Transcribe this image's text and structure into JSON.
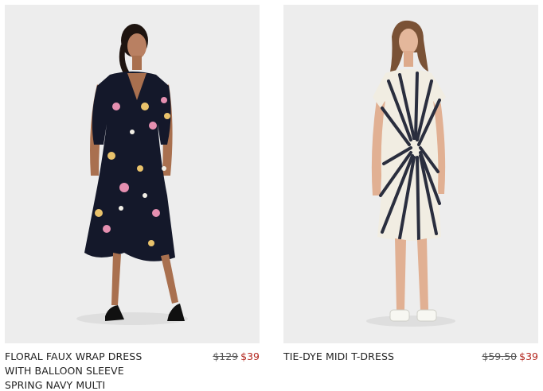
{
  "products": [
    {
      "name_lines": [
        "FLORAL FAUX WRAP DRESS",
        "WITH BALLOON SLEEVE",
        "SPRING NAVY MULTI"
      ],
      "original_price": "$129",
      "sale_price": "$39"
    },
    {
      "name_lines": [
        "TIE-DYE MIDI T-DRESS"
      ],
      "original_price": "$59.50",
      "sale_price": "$39"
    }
  ],
  "colors": {
    "photo_background": "#eeeeee",
    "sale_price": "#b3261e",
    "original_price": "#555555",
    "text": "#222222"
  },
  "icons": [
    "product-photo-floral-dress",
    "product-photo-tie-dye-dress"
  ]
}
